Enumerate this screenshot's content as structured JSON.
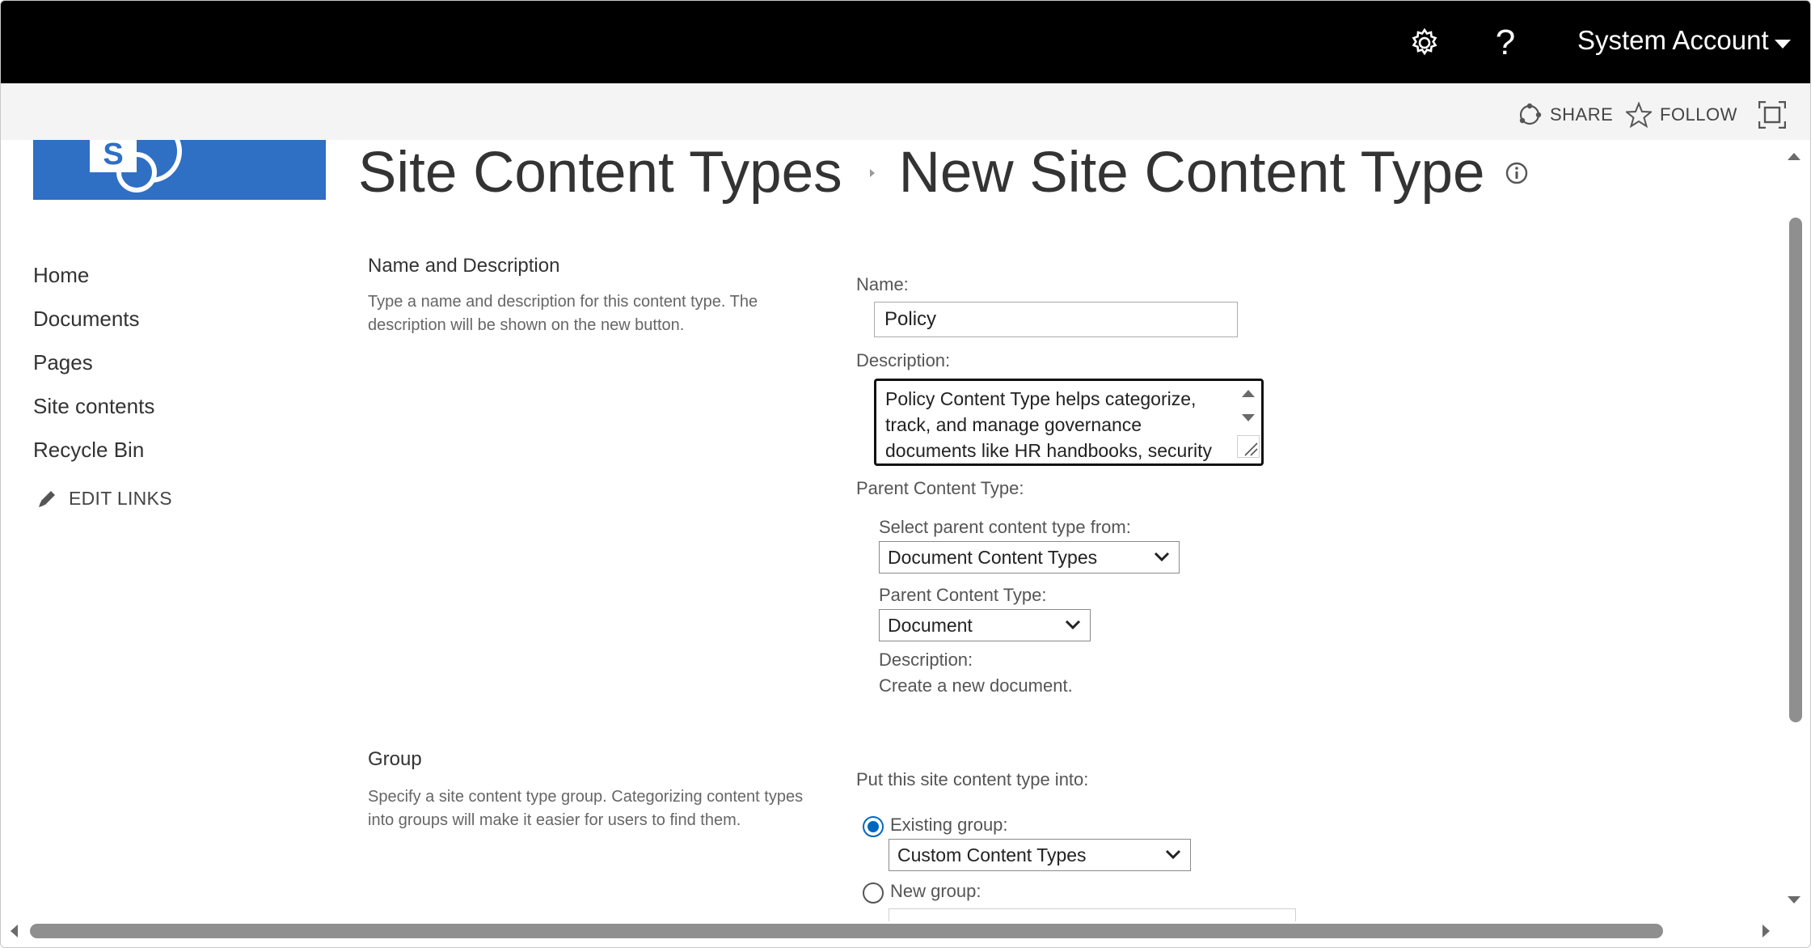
{
  "suite_bar": {
    "account_name": "System Account",
    "help_label": "?",
    "icons": [
      "gear-icon",
      "help-icon",
      "chevron-down-icon"
    ]
  },
  "action_bar": {
    "share_label": "SHARE",
    "follow_label": "FOLLOW"
  },
  "page": {
    "breadcrumb_parent": "Site Content Types",
    "breadcrumb_current": "New Site Content Type"
  },
  "left_nav": {
    "items": [
      {
        "label": "Home"
      },
      {
        "label": "Documents"
      },
      {
        "label": "Pages"
      },
      {
        "label": "Site contents"
      },
      {
        "label": "Recycle Bin"
      }
    ],
    "edit_links_label": "EDIT LINKS"
  },
  "name_section": {
    "title": "Name and Description",
    "description": "Type a name and description for this content type. The description will be shown on the new button.",
    "name_label": "Name:",
    "name_value": "Policy",
    "description_label": "Description:",
    "description_value": "Policy Content Type helps categorize, track, and manage governance documents like HR handbooks, security",
    "parent_content_type_heading": "Parent Content Type:",
    "select_parent_from_label": "Select parent content type from:",
    "select_parent_from_value": "Document Content Types",
    "parent_content_type_label": "Parent Content Type:",
    "parent_content_type_value": "Document",
    "parent_description_label": "Description:",
    "parent_description_value": "Create a new document."
  },
  "group_section": {
    "title": "Group",
    "description": "Specify a site content type group. Categorizing content types into groups will make it easier for users to find them.",
    "put_into_label": "Put this site content type into:",
    "existing_group_label": "Existing group:",
    "existing_group_value": "Custom Content Types",
    "existing_group_checked": true,
    "new_group_label": "New group:"
  },
  "colors": {
    "suite_bar_bg": "#000000",
    "action_bar_bg": "#f4f4f4",
    "site_logo_bg": "#2f6fc4",
    "radio_accent": "#0067c0"
  }
}
